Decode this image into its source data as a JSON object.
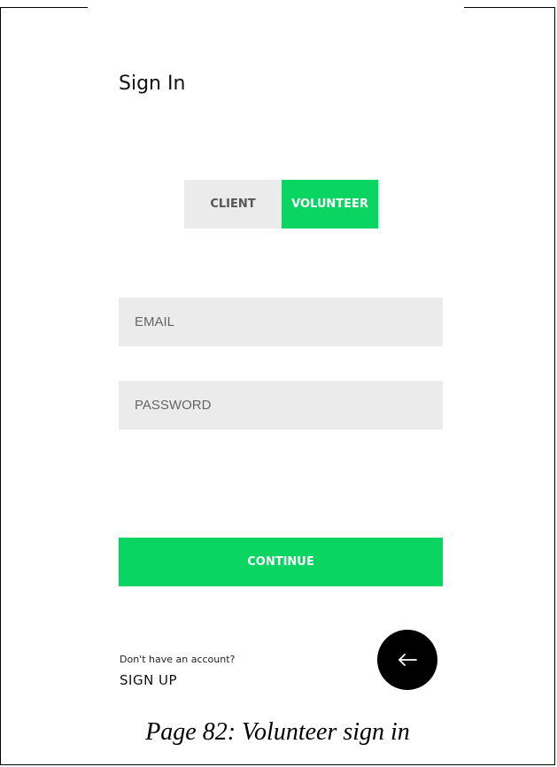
{
  "screen": {
    "title": "Sign In"
  },
  "role_toggle": {
    "options": [
      {
        "label": "CLIENT",
        "selected": false
      },
      {
        "label": "VOLUNTEER",
        "selected": true
      }
    ]
  },
  "form": {
    "email": {
      "placeholder": "EMAIL",
      "value": ""
    },
    "password": {
      "placeholder": "PASSWORD",
      "value": ""
    },
    "continue_label": "CONTINUE"
  },
  "footer": {
    "prompt": "Don't have an account?",
    "signup_label": "SIGN UP",
    "back_icon": "arrow-left-icon"
  },
  "caption": "Page 82: Volunteer sign in",
  "colors": {
    "accent": "#0ad563",
    "field_bg": "#ebebeb",
    "back_button": "#000000"
  }
}
